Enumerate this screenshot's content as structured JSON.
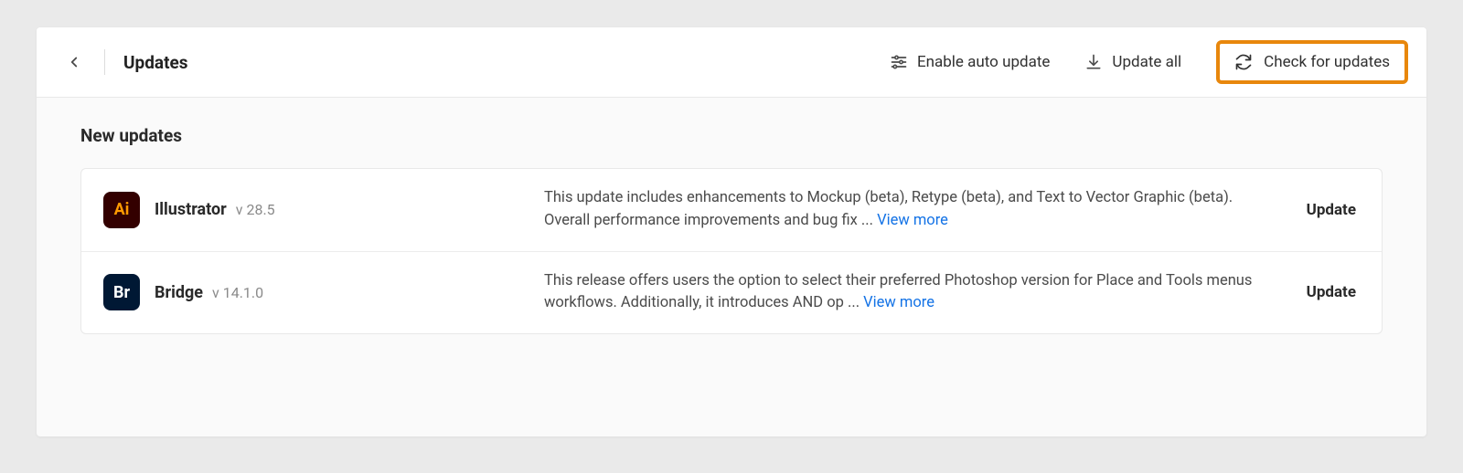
{
  "header": {
    "title": "Updates",
    "auto_update_label": "Enable auto update",
    "update_all_label": "Update all",
    "check_updates_label": "Check for updates"
  },
  "section_title": "New updates",
  "updates": [
    {
      "icon_text": "Ai",
      "icon_class": "ai",
      "name": "Illustrator",
      "version": "v 28.5",
      "description": "This update includes enhancements to Mockup (beta), Retype (beta), and Text to Vector Graphic (beta). Overall performance improvements and bug fix",
      "ellipsis": " ... ",
      "view_more": "View more",
      "button": "Update"
    },
    {
      "icon_text": "Br",
      "icon_class": "br",
      "name": "Bridge",
      "version": "v 14.1.0",
      "description": "This release offers users the option to select their preferred Photoshop version for Place and Tools menus workflows. Additionally, it introduces AND op",
      "ellipsis": " ... ",
      "view_more": "View more",
      "button": "Update"
    }
  ]
}
